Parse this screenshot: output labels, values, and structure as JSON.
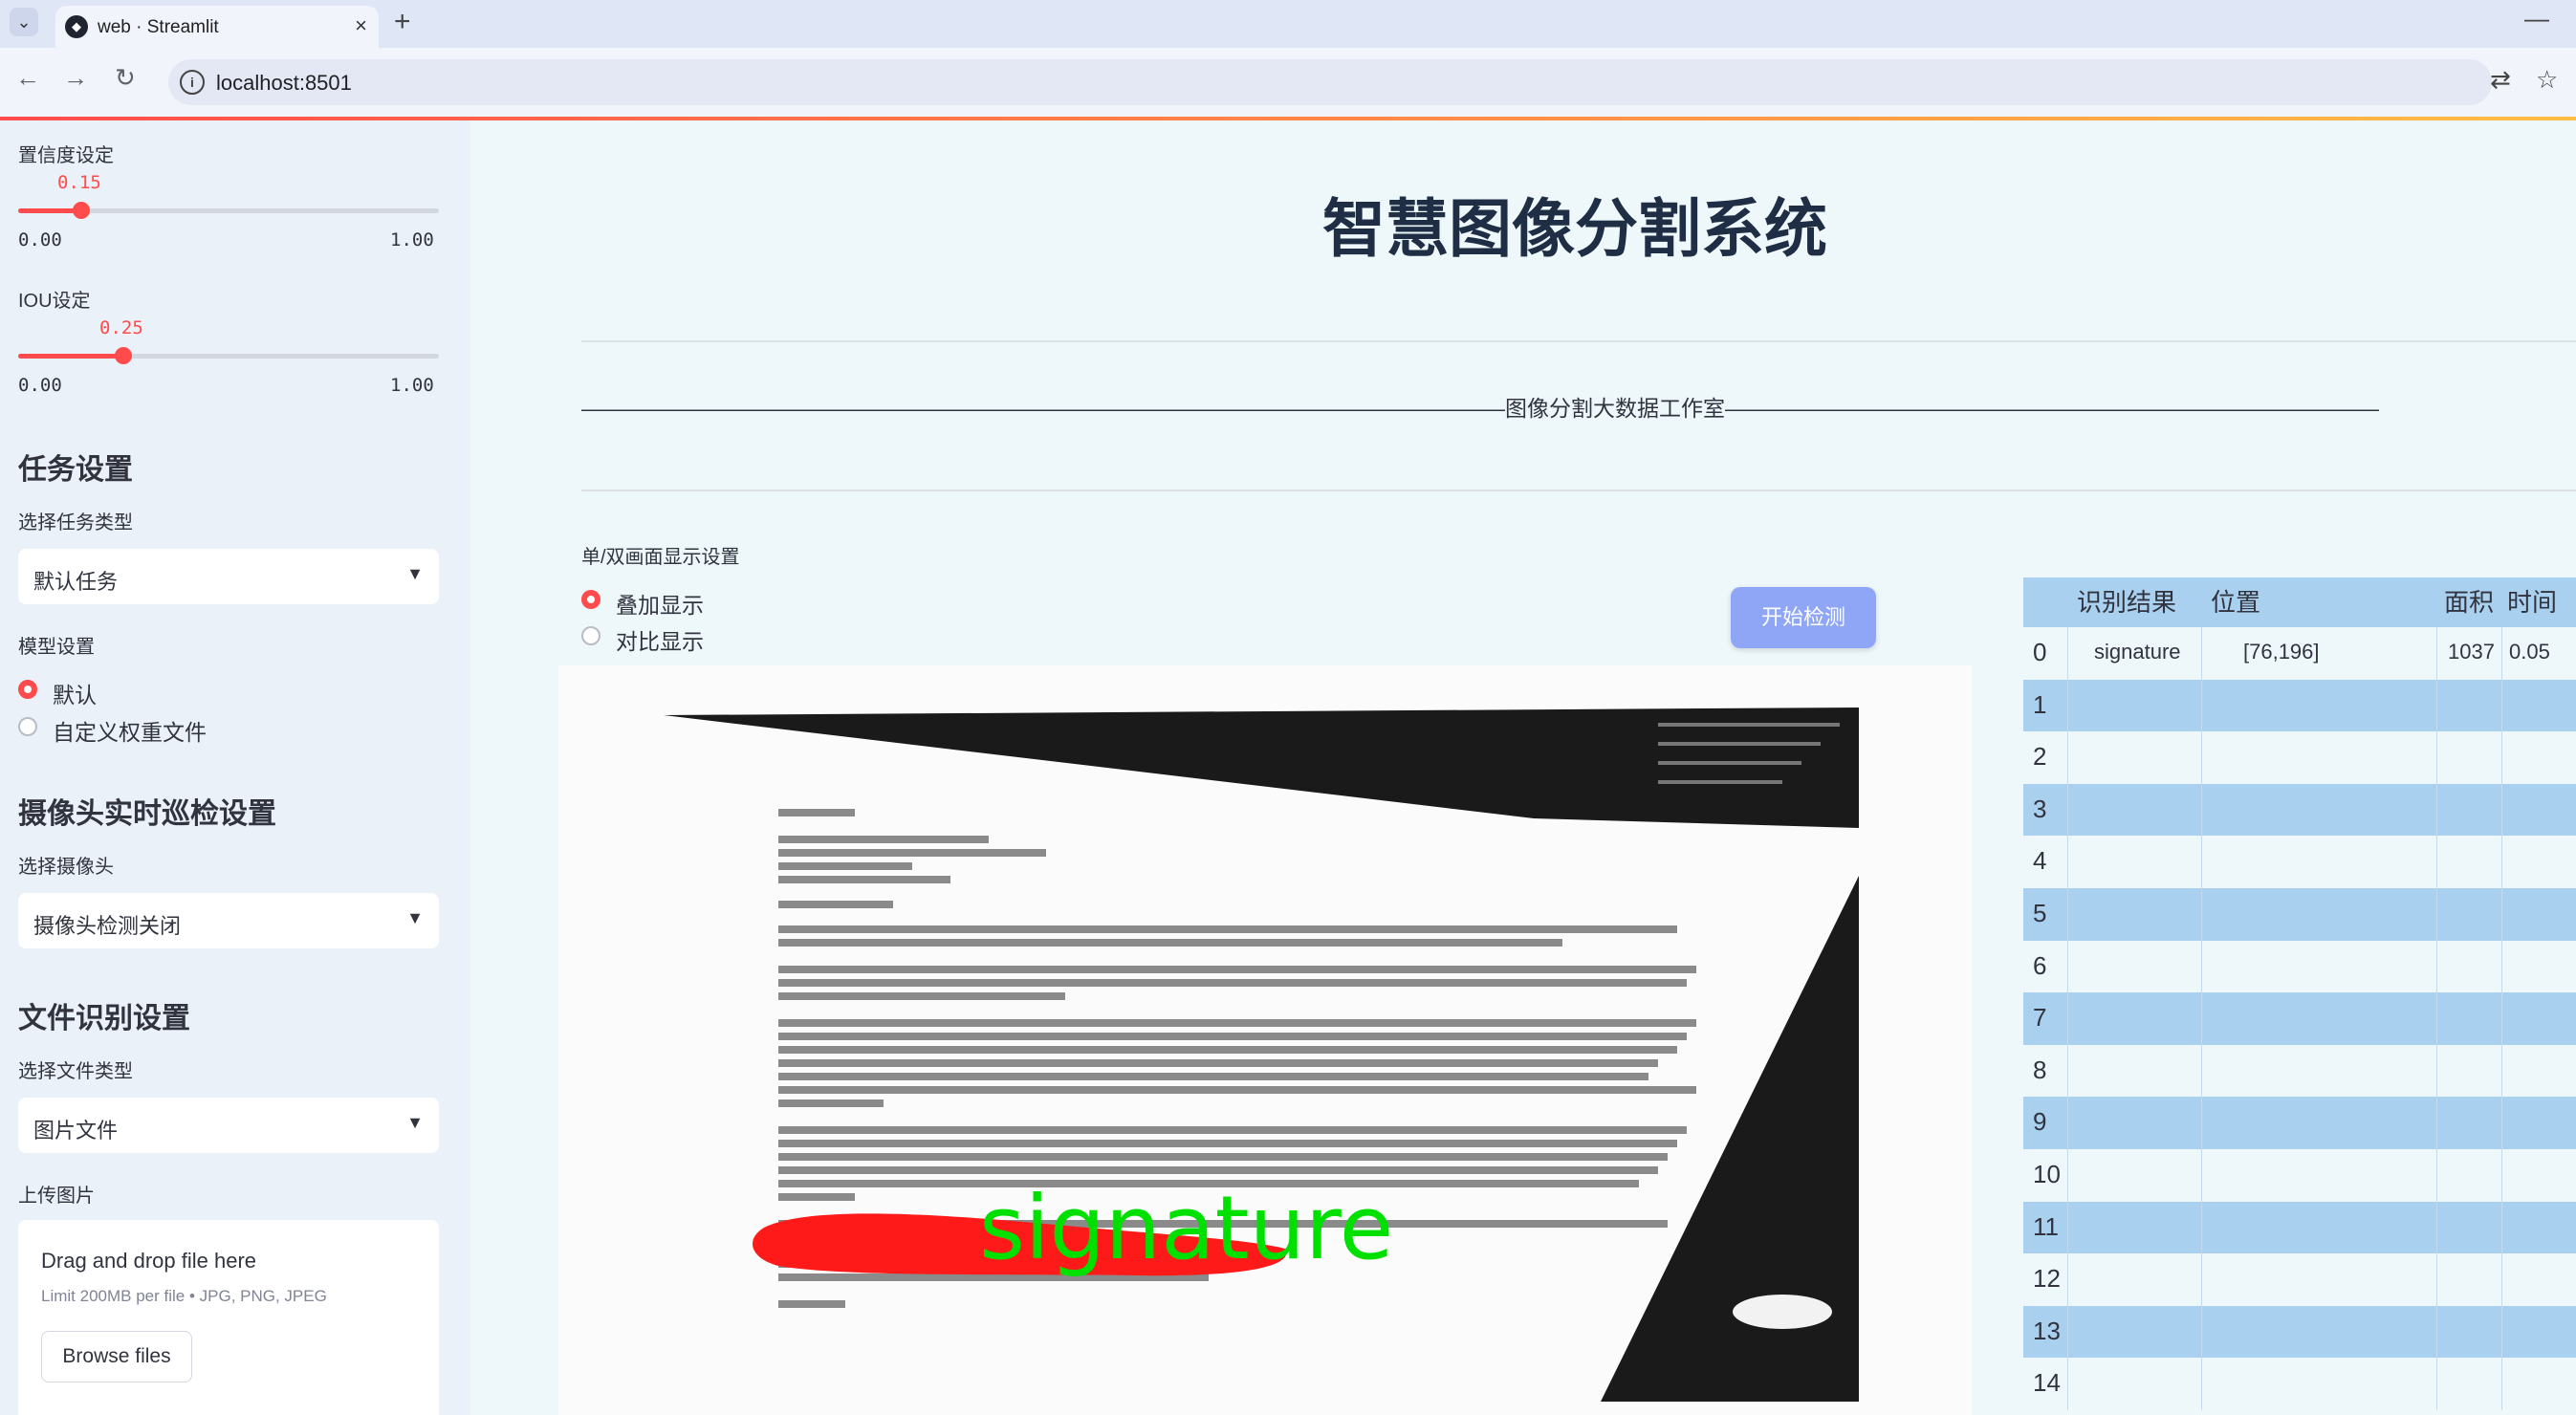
{
  "browser": {
    "tab_title": "web · Streamlit",
    "url": "localhost:8501"
  },
  "sidebar": {
    "confidence": {
      "label": "置信度设定",
      "value": "0.15",
      "min": "0.00",
      "max": "1.00",
      "fraction": 0.15
    },
    "iou": {
      "label": "IOU设定",
      "value": "0.25",
      "min": "0.00",
      "max": "1.00",
      "fraction": 0.25
    },
    "task_heading": "任务设置",
    "task_type_label": "选择任务类型",
    "task_type_value": "默认任务",
    "model_label": "模型设置",
    "model_options": [
      "默认",
      "自定义权重文件"
    ],
    "model_selected": 0,
    "camera_heading": "摄像头实时巡检设置",
    "camera_label": "选择摄像头",
    "camera_value": "摄像头检测关闭",
    "file_heading": "文件识别设置",
    "file_type_label": "选择文件类型",
    "file_type_value": "图片文件",
    "upload_label": "上传图片",
    "uploader": {
      "title": "Drag and drop file here",
      "limit": "Limit 200MB per file • JPG, PNG, JPEG",
      "button": "Browse files"
    }
  },
  "main": {
    "title": "智慧图像分割系统",
    "dashed_caption": "——————————————————————————————————————————图像分割大数据工作室——————————————————————————————————————————",
    "display_label": "单/双画面显示设置",
    "display_options": [
      "叠加显示",
      "对比显示"
    ],
    "display_selected": 0,
    "start_button": "开始检测",
    "detection_label": "signature"
  },
  "table": {
    "headers": [
      "",
      "识别结果",
      "位置",
      "面积",
      "时间"
    ],
    "rows": [
      [
        "0",
        "signature",
        "[76,196]",
        "1037",
        "0.05"
      ],
      [
        "1",
        "",
        "",
        "",
        ""
      ],
      [
        "2",
        "",
        "",
        "",
        ""
      ],
      [
        "3",
        "",
        "",
        "",
        ""
      ],
      [
        "4",
        "",
        "",
        "",
        ""
      ],
      [
        "5",
        "",
        "",
        "",
        ""
      ],
      [
        "6",
        "",
        "",
        "",
        ""
      ],
      [
        "7",
        "",
        "",
        "",
        ""
      ],
      [
        "8",
        "",
        "",
        "",
        ""
      ],
      [
        "9",
        "",
        "",
        "",
        ""
      ],
      [
        "10",
        "",
        "",
        "",
        ""
      ],
      [
        "11",
        "",
        "",
        "",
        ""
      ],
      [
        "12",
        "",
        "",
        "",
        ""
      ],
      [
        "13",
        "",
        "",
        "",
        ""
      ],
      [
        "14",
        "",
        "",
        "",
        ""
      ]
    ]
  },
  "colors": {
    "accent": "#ff4b4b",
    "sidebar_bg": "#eaf1f8",
    "main_bg": "#eef8fb",
    "table_stripe": "#a9d0ef",
    "button": "#8fa6f7",
    "mask_red": "#ff1a1a",
    "label_green": "#00e000"
  }
}
